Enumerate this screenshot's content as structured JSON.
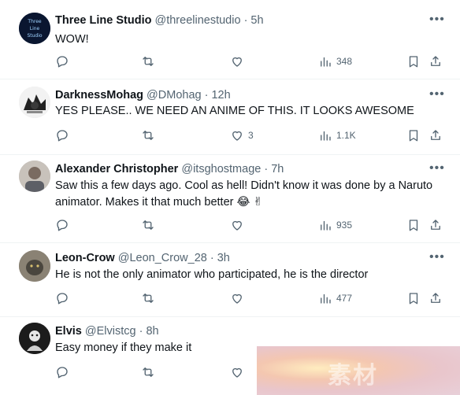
{
  "tweets": [
    {
      "name": "Three Line Studio",
      "handle": "@threelinestudio",
      "time": "· 5h",
      "text": "WOW!",
      "replies": "",
      "reposts": "",
      "likes": "",
      "views": "348",
      "avatar_text": "Three Line Studio"
    },
    {
      "name": "DarknessMohag",
      "handle": "@DMohag",
      "time": "· 12h",
      "text": "YES PLEASE.. WE NEED AN ANIME OF THIS. IT LOOKS AWESOME",
      "replies": "",
      "reposts": "",
      "likes": "3",
      "views": "1.1K"
    },
    {
      "name": "Alexander Christopher",
      "handle": "@itsghostmage",
      "time": "· 7h",
      "text_line1": "Saw this a few days ago.  Cool as hell! Didn't know it was done by a Naruto",
      "text_line2": "animator.  Makes it that much better 😂 ✌",
      "replies": "",
      "reposts": "",
      "likes": "",
      "views": "935"
    },
    {
      "name": "Leon-Crow",
      "handle": "@Leon_Crow_28",
      "time": "· 3h",
      "text": "He is not the only animator who participated, he is the director",
      "replies": "",
      "reposts": "",
      "likes": "",
      "views": "477"
    },
    {
      "name": "Elvis",
      "handle": "@Elvistcg",
      "time": "· 8h",
      "text": "Easy money if they make it",
      "replies": "",
      "reposts": "",
      "likes": "",
      "views": ""
    }
  ],
  "more_label": "•••",
  "watermark": "素材",
  "icons": {
    "reply": "reply-icon",
    "repost": "repost-icon",
    "like": "heart-icon",
    "views": "views-icon",
    "bookmark": "bookmark-icon",
    "share": "share-icon",
    "more": "more-icon"
  },
  "colors": {
    "text": "#0f1419",
    "secondary": "#536471",
    "divider": "#eff3f4"
  }
}
